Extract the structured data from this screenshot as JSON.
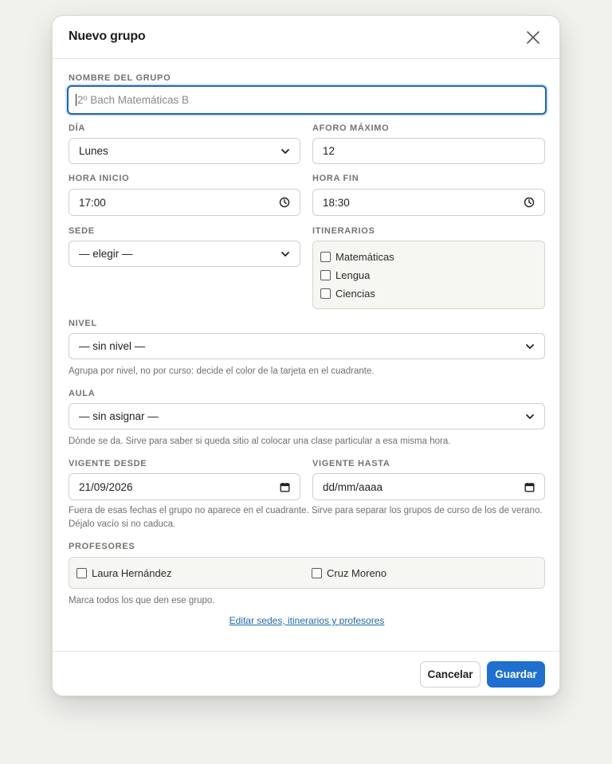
{
  "dialog": {
    "title": "Nuevo grupo",
    "close_icon": "close-icon"
  },
  "form": {
    "nombre": {
      "label": "NOMBRE DEL GRUPO",
      "placeholder": "2º Bach Matemáticas B"
    },
    "dia": {
      "label": "DÍA",
      "value": "Lunes"
    },
    "aforo": {
      "label": "AFORO MÁXIMO",
      "value": "12"
    },
    "hora_inicio": {
      "label": "HORA INICIO",
      "value": "17:00"
    },
    "hora_fin": {
      "label": "HORA FIN",
      "value": "18:30"
    },
    "sede": {
      "label": "SEDE",
      "value": "— elegir —"
    },
    "itinerarios": {
      "label": "ITINERARIOS",
      "options": [
        "Matemáticas",
        "Lengua",
        "Ciencias"
      ]
    },
    "nivel": {
      "label": "NIVEL",
      "value": "— sin nivel —",
      "hint": "Agrupa por nivel, no por curso: decide el color de la tarjeta en el cuadrante."
    },
    "aula": {
      "label": "AULA",
      "value": "— sin asignar —",
      "hint": "Dónde se da. Sirve para saber si queda sitio al colocar una clase particular a esa misma hora."
    },
    "vigente_desde": {
      "label": "VIGENTE DESDE",
      "value": "21/09/2026"
    },
    "vigente_hasta": {
      "label": "VIGENTE HASTA",
      "value": "dd/mm/aaaa"
    },
    "vigencia_hint_1": "Fuera de esas fechas el grupo no aparece en el cuadrante. Sirve para separar los grupos de curso de los de verano.",
    "vigencia_hint_2": "Déjalo vacío si no caduca.",
    "profesores": {
      "label": "PROFESORES",
      "options": [
        "Laura Hernández",
        "Cruz Moreno"
      ],
      "hint": "Marca todos los que den ese grupo."
    },
    "edit_link": "Editar sedes, itinerarios y profesores"
  },
  "footer": {
    "cancel_label": "Cancelar",
    "save_label": "Guardar"
  },
  "colors": {
    "accent": "#1f6fcf",
    "focus_border": "#1f67b1",
    "page_background": "#f1f2ee"
  }
}
